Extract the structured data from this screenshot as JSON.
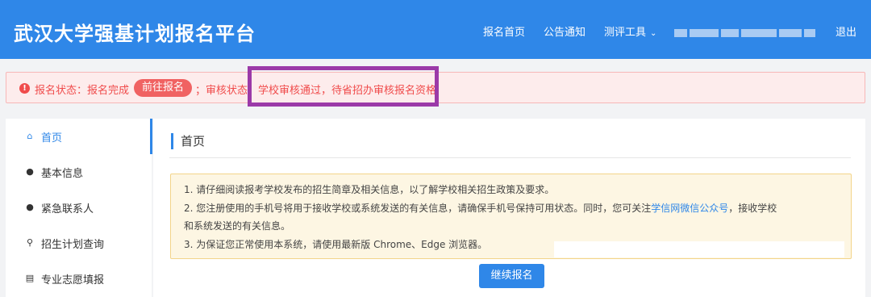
{
  "header": {
    "brand": "武汉大学强基计划报名平台",
    "nav": {
      "home": "报名首页",
      "notice": "公告通知",
      "tools": "测评工具",
      "logout": "退出"
    }
  },
  "alert": {
    "status_text": "报名状态：报名完成",
    "goto_button": "前往报名",
    "review_text": "；审核状态：学校审核通过，待省招办审核报名资格"
  },
  "sidebar": {
    "items": [
      {
        "label": "首页",
        "icon": "home-icon"
      },
      {
        "label": "基本信息",
        "icon": "user-icon"
      },
      {
        "label": "紧急联系人",
        "icon": "user-icon"
      },
      {
        "label": "招生计划查询",
        "icon": "search-icon"
      },
      {
        "label": "专业志愿填报",
        "icon": "list-icon"
      }
    ]
  },
  "main": {
    "title": "首页",
    "notice": {
      "line1": "1. 请仔细阅读报考学校发布的招生简章及相关信息，以了解学校相关招生政策及要求。",
      "line2_before": "2. 您注册使用的手机号将用于接收学校或系统发送的有关信息，请确保手机号保持可用状态。同时，您可关注",
      "line2_link": "学信网微信公众号",
      "line2_after": "，接收学校",
      "line3": "和系统发送的有关信息。",
      "line4": "3. 为保证您正常使用本系统，请使用最新版 Chrome、Edge 浏览器。"
    },
    "continue_button": "继续报名"
  }
}
